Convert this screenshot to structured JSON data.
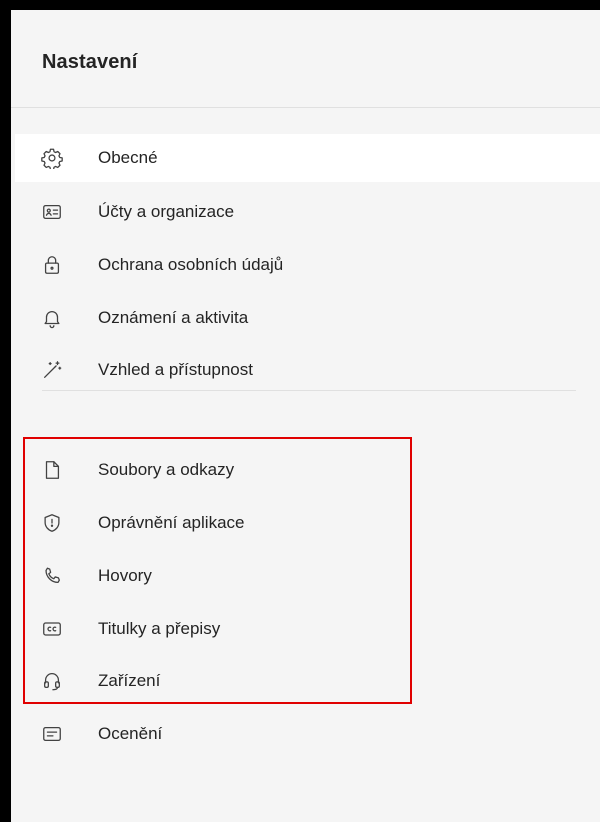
{
  "settings": {
    "title": "Nastavení",
    "items": [
      {
        "label": "Obecné",
        "icon": "gear-icon",
        "selected": true
      },
      {
        "label": "Účty a organizace",
        "icon": "id-card-icon"
      },
      {
        "label": "Ochrana osobních údajů",
        "icon": "lock-icon"
      },
      {
        "label": "Oznámení a aktivita",
        "icon": "bell-icon"
      },
      {
        "label": "Vzhled a přístupnost",
        "icon": "magic-wand-icon"
      },
      {
        "label": "Soubory a odkazy",
        "icon": "document-icon"
      },
      {
        "label": "Oprávnění aplikace",
        "icon": "shield-icon"
      },
      {
        "label": "Hovory",
        "icon": "phone-icon"
      },
      {
        "label": "Titulky a přepisy",
        "icon": "closed-captions-icon"
      },
      {
        "label": "Zařízení",
        "icon": "headset-icon"
      },
      {
        "label": "Ocenění",
        "icon": "card-text-icon"
      }
    ]
  },
  "colors": {
    "panel_background": "#f5f5f5",
    "selected_background": "#ffffff",
    "highlight_border": "#e00000",
    "text": "#242424"
  }
}
